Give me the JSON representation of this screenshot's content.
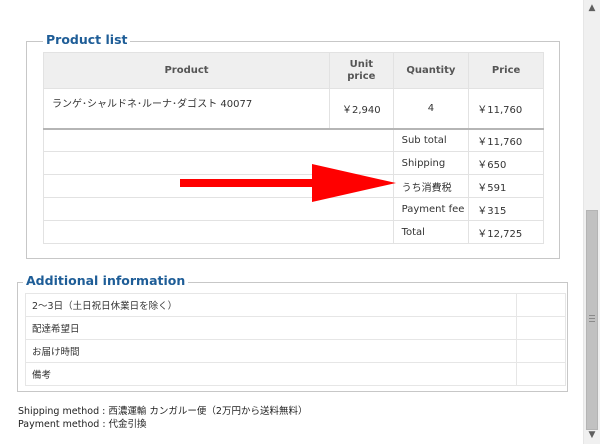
{
  "product_list": {
    "legend": "Product list",
    "headers": {
      "product": "Product",
      "unit_price": "Unit price",
      "quantity": "Quantity",
      "price": "Price"
    },
    "item": {
      "name": "ランゲ･シャルドネ･ルーナ･ダゴスト 40077",
      "unit_price": "￥2,940",
      "quantity": "4",
      "price": "￥11,760"
    },
    "summary": [
      {
        "label": "Sub total",
        "value": "￥11,760"
      },
      {
        "label": "Shipping",
        "value": "￥650"
      },
      {
        "label": "うち消費税",
        "value": "￥591"
      },
      {
        "label": "Payment fee",
        "value": "￥315"
      },
      {
        "label": "Total",
        "value": "￥12,725"
      }
    ]
  },
  "additional_info": {
    "legend": "Additional information",
    "rows": [
      "2～3日（土日祝日休業日を除く）",
      "配達希望日",
      "お届け時間",
      "備考"
    ]
  },
  "shipping_method": "Shipping method : 西濃運輸 カンガルー便（2万円から送料無料）",
  "payment_method": "Payment method : 代金引換",
  "annotation": {
    "arrow_color": "#ff0000"
  }
}
